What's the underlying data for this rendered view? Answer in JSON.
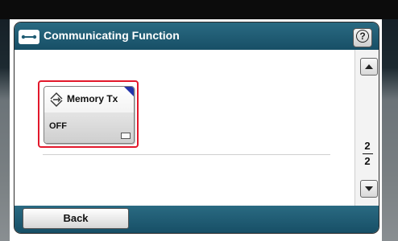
{
  "title": "Communicating Function",
  "icons": {
    "title": "communication-line-icon",
    "help": "help-question-icon",
    "tile": "memory-transmit-icon",
    "scroll_up": "triangle-up-icon",
    "scroll_down": "triangle-down-icon"
  },
  "help_label": "?",
  "tile": {
    "label": "Memory Tx",
    "value": "OFF"
  },
  "pagination": {
    "current": "2",
    "total": "2"
  },
  "back_label": "Back",
  "colors": {
    "bar": "#1f5c73",
    "highlight": "#e2182b",
    "corner_flag": "#2233aa"
  }
}
